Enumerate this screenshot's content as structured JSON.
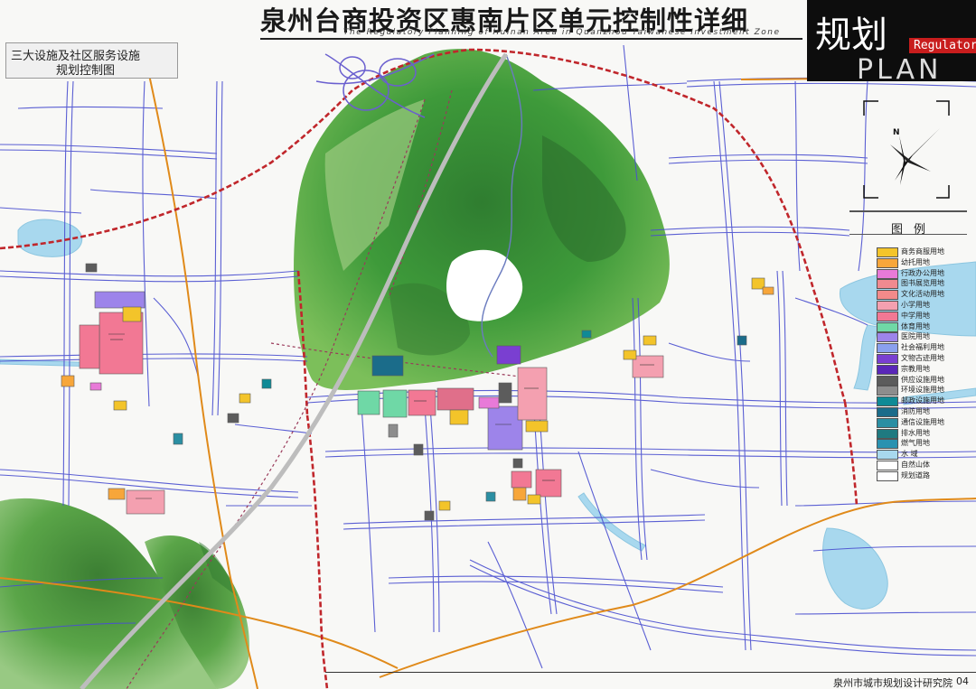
{
  "header": {
    "title": "泉州台商投资区惠南片区单元控制性详细",
    "subtitle": "The Regulatory Planning of Huinan Area in Quanzhou Taiwanese Investment Zone",
    "corner_cn": "规划",
    "corner_tag": "Regulatory",
    "corner_en": "PLAN"
  },
  "sheet": {
    "line1": "三大设施及社区服务设施",
    "line2": "规划控制图"
  },
  "compass": {
    "label": "N"
  },
  "legend": {
    "title": "图例",
    "items": [
      {
        "label": "商务商服用地",
        "color": "#f3c42a"
      },
      {
        "label": "幼托用地",
        "color": "#f7a63a"
      },
      {
        "label": "行政办公用地",
        "color": "#e87ad8"
      },
      {
        "label": "图书展览用地",
        "color": "#f08a90"
      },
      {
        "label": "文化活动用地",
        "color": "#f28a8a"
      },
      {
        "label": "小学用地",
        "color": "#f4a0b0"
      },
      {
        "label": "中学用地",
        "color": "#f27894"
      },
      {
        "label": "体育用地",
        "color": "#6fd8a6"
      },
      {
        "label": "医院用地",
        "color": "#9d84ea"
      },
      {
        "label": "社会福利用地",
        "color": "#8aa0ee"
      },
      {
        "label": "文物古迹用地",
        "color": "#7a3fd1"
      },
      {
        "label": "宗教用地",
        "color": "#5a27b8"
      },
      {
        "label": "供应设施用地",
        "color": "#5c5c5c"
      },
      {
        "label": "环境设施用地",
        "color": "#8d8d8d"
      },
      {
        "label": "邮政设施用地",
        "color": "#0f8a96"
      },
      {
        "label": "消防用地",
        "color": "#1b6c8a"
      },
      {
        "label": "通信设施用地",
        "color": "#2b8fa3"
      },
      {
        "label": "排水用地",
        "color": "#1f7a80"
      },
      {
        "label": "燃气用地",
        "color": "#2a92b0"
      },
      {
        "label": "水 域",
        "color": "#a8d8ee"
      },
      {
        "label": "自然山体",
        "color": "#ffffff"
      },
      {
        "label": "规划道路",
        "color": "#ffffff"
      }
    ]
  },
  "footer": {
    "org": "泉州市城市规划设计研究院",
    "page": "04"
  },
  "colors": {
    "road": "#4a4fd0",
    "expressway": "#e08a1a",
    "rail": "#c0262b",
    "water": "#a8d8ee",
    "forest": "#3f8e35"
  }
}
